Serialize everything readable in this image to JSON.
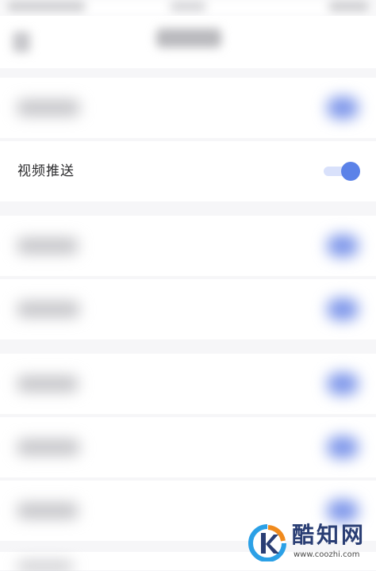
{
  "settings": {
    "items": [
      {
        "label": "视频推送",
        "enabled": true
      }
    ]
  },
  "toggle_colors": {
    "on_knob": "#5b82e8",
    "on_track": "#d9e1fb"
  },
  "watermark": {
    "name": "酷知网",
    "url": "www.coozhi.com"
  }
}
